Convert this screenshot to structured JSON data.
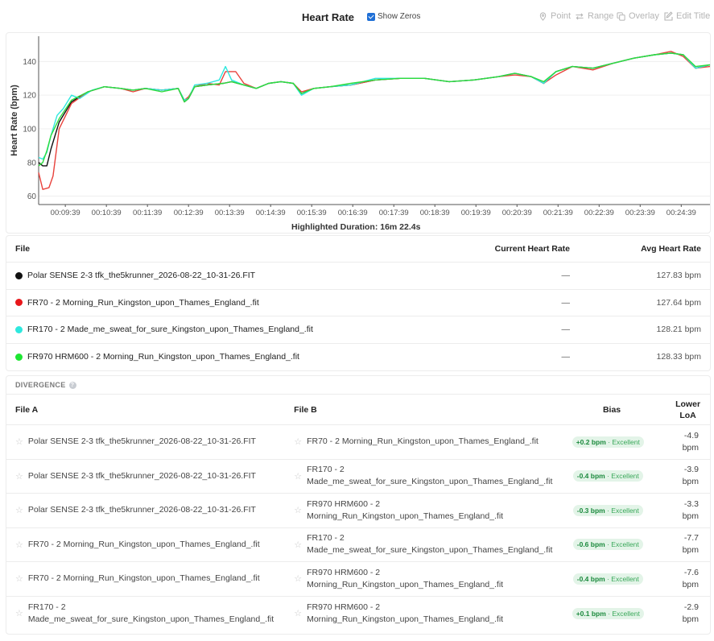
{
  "header": {
    "title": "Heart Rate",
    "show_zeros": "Show Zeros",
    "tools": {
      "point": "Point",
      "range": "Range",
      "overlay": "Overlay",
      "edit_title": "Edit Title"
    }
  },
  "highlighted_duration": "Highlighted Duration: 16m 22.4s",
  "chart_data": {
    "type": "line",
    "ylabel": "Heart Rate (bpm)",
    "xlabel": "",
    "ylim": [
      55,
      155
    ],
    "xlim": [
      9.0,
      25.35
    ],
    "x_unit": "minutes of clock time, 00:MM:SS",
    "y_ticks": [
      "60",
      "80",
      "100",
      "120",
      "140"
    ],
    "x_ticks": [
      "00:09:39",
      "00:10:39",
      "00:11:39",
      "00:12:39",
      "00:13:39",
      "00:14:39",
      "00:15:39",
      "00:16:39",
      "00:17:39",
      "00:18:39",
      "00:19:39",
      "00:20:39",
      "00:21:39",
      "00:22:39",
      "00:23:39",
      "00:24:39"
    ],
    "grid": "horizontal",
    "series": [
      {
        "name": "Polar SENSE 2-3 tfk_the5krunner_2026-08-22_10-31-26.FIT",
        "color": "#111111",
        "x": [
          9.0,
          9.1,
          9.2,
          9.3,
          9.5,
          9.8,
          10.2,
          10.6,
          11.0,
          11.3,
          11.6,
          12.0,
          12.4,
          12.55,
          12.65,
          12.8,
          13.1,
          13.5,
          13.7,
          14.0,
          14.3,
          14.6,
          14.9,
          15.2,
          15.4,
          15.7,
          16.1,
          16.6,
          17.2,
          17.8,
          18.4,
          19.0,
          19.6,
          20.2,
          20.6,
          21.0,
          21.3,
          21.6,
          22.0,
          22.5,
          23.0,
          23.5,
          24.0,
          24.4,
          24.7,
          25.0,
          25.35
        ],
        "y": [
          80,
          78,
          78,
          88,
          104,
          116,
          122,
          125,
          124,
          123,
          124,
          123,
          124,
          116,
          118,
          125,
          126,
          127,
          128,
          126,
          124,
          127,
          128,
          127,
          121,
          124,
          125,
          126,
          129,
          130,
          130,
          128,
          129,
          131,
          133,
          131,
          127,
          134,
          137,
          136,
          139,
          142,
          144,
          145,
          144,
          136,
          138
        ]
      },
      {
        "name": "FR70 - 2 Morning_Run_Kingston_upon_Thames_England_.fit",
        "color": "#e8423c",
        "x": [
          9.0,
          9.1,
          9.25,
          9.35,
          9.5,
          9.8,
          10.2,
          10.6,
          11.0,
          11.3,
          11.6,
          12.0,
          12.4,
          12.55,
          12.65,
          12.8,
          13.1,
          13.4,
          13.55,
          13.8,
          14.0,
          14.3,
          14.6,
          14.9,
          15.2,
          15.4,
          15.7,
          16.1,
          16.6,
          17.2,
          17.8,
          18.4,
          19.0,
          19.6,
          20.2,
          20.6,
          21.0,
          21.3,
          21.6,
          22.0,
          22.5,
          23.0,
          23.5,
          24.0,
          24.4,
          24.7,
          25.0,
          25.35
        ],
        "y": [
          74,
          64,
          65,
          72,
          100,
          115,
          122,
          125,
          124,
          122,
          124,
          123,
          124,
          117,
          119,
          125,
          127,
          126,
          134,
          134,
          127,
          124,
          127,
          128,
          127,
          122,
          124,
          125,
          126,
          129,
          130,
          130,
          128,
          129,
          131,
          132,
          131,
          127,
          132,
          137,
          135,
          139,
          142,
          144,
          146,
          143,
          136,
          137
        ]
      },
      {
        "name": "FR170 - 2 Made_me_sweat_for_sure_Kingston_upon_Thames_England_.fit",
        "color": "#2ee8de",
        "x": [
          9.0,
          9.1,
          9.2,
          9.3,
          9.45,
          9.6,
          9.8,
          10.0,
          10.3,
          10.6,
          11.0,
          11.3,
          11.6,
          12.0,
          12.4,
          12.55,
          12.65,
          12.8,
          13.1,
          13.4,
          13.55,
          13.7,
          14.0,
          14.3,
          14.6,
          14.9,
          15.2,
          15.4,
          15.7,
          16.1,
          16.6,
          17.2,
          17.8,
          18.4,
          19.0,
          19.6,
          20.2,
          20.6,
          21.0,
          21.3,
          21.6,
          22.0,
          22.5,
          23.0,
          23.5,
          24.0,
          24.4,
          24.7,
          25.0,
          25.35
        ],
        "y": [
          83,
          82,
          86,
          96,
          108,
          112,
          120,
          118,
          123,
          125,
          124,
          123,
          124,
          123,
          124,
          117,
          118,
          126,
          127,
          129,
          137,
          129,
          126,
          124,
          127,
          128,
          127,
          120,
          124,
          125,
          126,
          130,
          130,
          130,
          128,
          129,
          131,
          133,
          131,
          127,
          134,
          137,
          136,
          139,
          142,
          144,
          145,
          144,
          136,
          138
        ]
      },
      {
        "name": "FR970 HRM600 - 2 Morning_Run_Kingston_upon_Thames_England_.fit",
        "color": "#2ddc3c",
        "x": [
          9.0,
          9.1,
          9.2,
          9.3,
          9.5,
          9.8,
          10.2,
          10.6,
          11.0,
          11.3,
          11.6,
          12.0,
          12.4,
          12.55,
          12.65,
          12.8,
          13.1,
          13.5,
          13.7,
          14.0,
          14.3,
          14.6,
          14.9,
          15.2,
          15.4,
          15.7,
          16.1,
          16.6,
          17.2,
          17.8,
          18.4,
          19.0,
          19.6,
          20.2,
          20.6,
          21.0,
          21.3,
          21.6,
          22.0,
          22.5,
          23.0,
          23.5,
          24.0,
          24.4,
          24.7,
          25.0,
          25.35
        ],
        "y": [
          78,
          80,
          87,
          96,
          106,
          117,
          122,
          125,
          124,
          123,
          124,
          122,
          124,
          116,
          118,
          125,
          126,
          127,
          128,
          126,
          124,
          127,
          128,
          127,
          121,
          124,
          125,
          127,
          129,
          130,
          130,
          128,
          129,
          131,
          133,
          131,
          128,
          134,
          137,
          136,
          139,
          142,
          144,
          145,
          144,
          137,
          138
        ]
      }
    ]
  },
  "files_table": {
    "headers": {
      "file": "File",
      "current": "Current Heart Rate",
      "avg": "Avg Heart Rate"
    },
    "rows": [
      {
        "file": "Polar SENSE 2-3 tfk_the5krunner_2026-08-22_10-31-26.FIT",
        "color": "#111111",
        "current": "—",
        "avg": "127.83 bpm"
      },
      {
        "file": "FR70 - 2 Morning_Run_Kingston_upon_Thames_England_.fit",
        "color": "#e8171b",
        "current": "—",
        "avg": "127.64 bpm"
      },
      {
        "file": "FR170 - 2 Made_me_sweat_for_sure_Kingston_upon_Thames_England_.fit",
        "color": "#2ee8de",
        "current": "—",
        "avg": "128.21 bpm"
      },
      {
        "file": "FR970 HRM600 - 2 Morning_Run_Kingston_upon_Thames_England_.fit",
        "color": "#1ee632",
        "current": "—",
        "avg": "128.33 bpm"
      }
    ]
  },
  "divergence": {
    "title": "DIVERGENCE",
    "headers": {
      "file_a": "File A",
      "file_b": "File B",
      "bias": "Bias",
      "loa_1": "Lower",
      "loa_2": "LoA"
    },
    "rows": [
      {
        "a1": "Polar SENSE 2-3 tfk_the5krunner_2026-08-22_10-31-26.FIT",
        "a2": "",
        "b1": "FR70 - 2 Morning_Run_Kingston_upon_Thames_England_.fit",
        "b2": "",
        "bias": "+0.2 bpm",
        "rating": "· Excellent",
        "loa_v": "-4.9",
        "loa_u": "bpm"
      },
      {
        "a1": "Polar SENSE 2-3 tfk_the5krunner_2026-08-22_10-31-26.FIT",
        "a2": "",
        "b1": "FR170 - 2",
        "b2": "Made_me_sweat_for_sure_Kingston_upon_Thames_England_.fit",
        "bias": "-0.4 bpm",
        "rating": "· Excellent",
        "loa_v": "-3.9",
        "loa_u": "bpm"
      },
      {
        "a1": "Polar SENSE 2-3 tfk_the5krunner_2026-08-22_10-31-26.FIT",
        "a2": "",
        "b1": "FR970 HRM600 - 2",
        "b2": "Morning_Run_Kingston_upon_Thames_England_.fit",
        "bias": "-0.3 bpm",
        "rating": "· Excellent",
        "loa_v": "-3.3",
        "loa_u": "bpm"
      },
      {
        "a1": "FR70 - 2 Morning_Run_Kingston_upon_Thames_England_.fit",
        "a2": "",
        "b1": "FR170 - 2",
        "b2": "Made_me_sweat_for_sure_Kingston_upon_Thames_England_.fit",
        "bias": "-0.6 bpm",
        "rating": "· Excellent",
        "loa_v": "-7.7",
        "loa_u": "bpm"
      },
      {
        "a1": "FR70 - 2 Morning_Run_Kingston_upon_Thames_England_.fit",
        "a2": "",
        "b1": "FR970 HRM600 - 2",
        "b2": "Morning_Run_Kingston_upon_Thames_England_.fit",
        "bias": "-0.4 bpm",
        "rating": "· Excellent",
        "loa_v": "-7.6",
        "loa_u": "bpm"
      },
      {
        "a1": "FR170 - 2",
        "a2": "Made_me_sweat_for_sure_Kingston_upon_Thames_England_.fit",
        "b1": "FR970 HRM600 - 2",
        "b2": "Morning_Run_Kingston_upon_Thames_England_.fit",
        "bias": "+0.1 bpm",
        "rating": "· Excellent",
        "loa_v": "-2.9",
        "loa_u": "bpm"
      }
    ]
  }
}
